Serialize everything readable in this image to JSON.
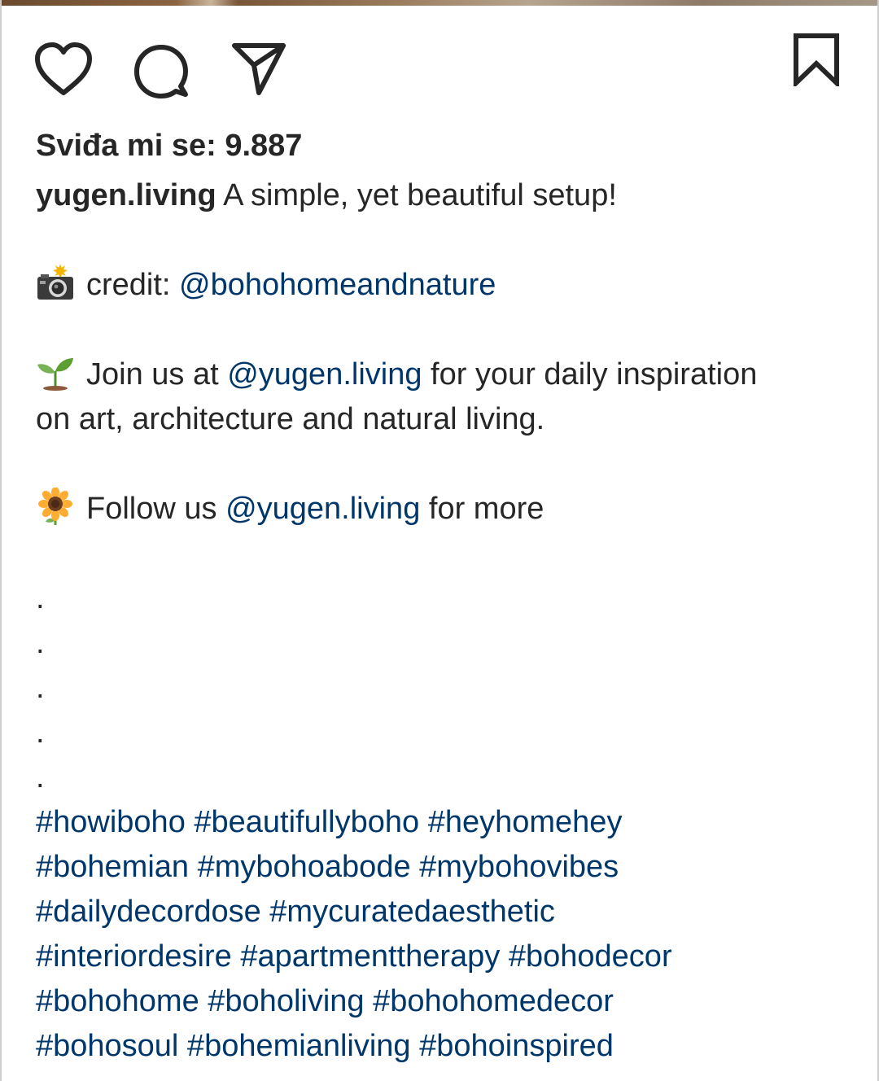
{
  "post": {
    "likes_text": "Sviđa mi se: 9.887",
    "username": "yugen.living",
    "caption_text": " A simple, yet beautiful setup!",
    "credit_label": "credit: ",
    "credit_mention": "@bohohomeandnature",
    "join_prefix": "Join us at ",
    "join_mention": "@yugen.living",
    "join_suffix": " for your daily inspiration",
    "join_line2": "on art, architecture and natural living.",
    "follow_prefix": "Follow us ",
    "follow_mention": "@yugen.living",
    "follow_suffix": " for more",
    "dots": [
      ".",
      ".",
      ".",
      ".",
      "."
    ],
    "hashtag_lines": [
      "#howiboho #beautifullyboho #heyhomehey",
      "#bohemian #mybohoabode #mybohovibes",
      "#dailydecordose #mycuratedaesthetic",
      "#interiordesire #apartmenttherapy #bohodecor",
      "#bohohome #boholiving #bohohomedecor",
      "#bohosoul #bohemianliving #bohoinspired"
    ]
  },
  "icons": {
    "like": "heart-icon",
    "comment": "comment-bubble-icon",
    "share": "paper-plane-icon",
    "save": "bookmark-icon",
    "credit_emoji": "camera-flash-emoji",
    "join_emoji": "seedling-emoji",
    "follow_emoji": "sunflower-emoji"
  },
  "colors": {
    "text": "#262626",
    "link": "#00376b",
    "background": "#ffffff"
  }
}
